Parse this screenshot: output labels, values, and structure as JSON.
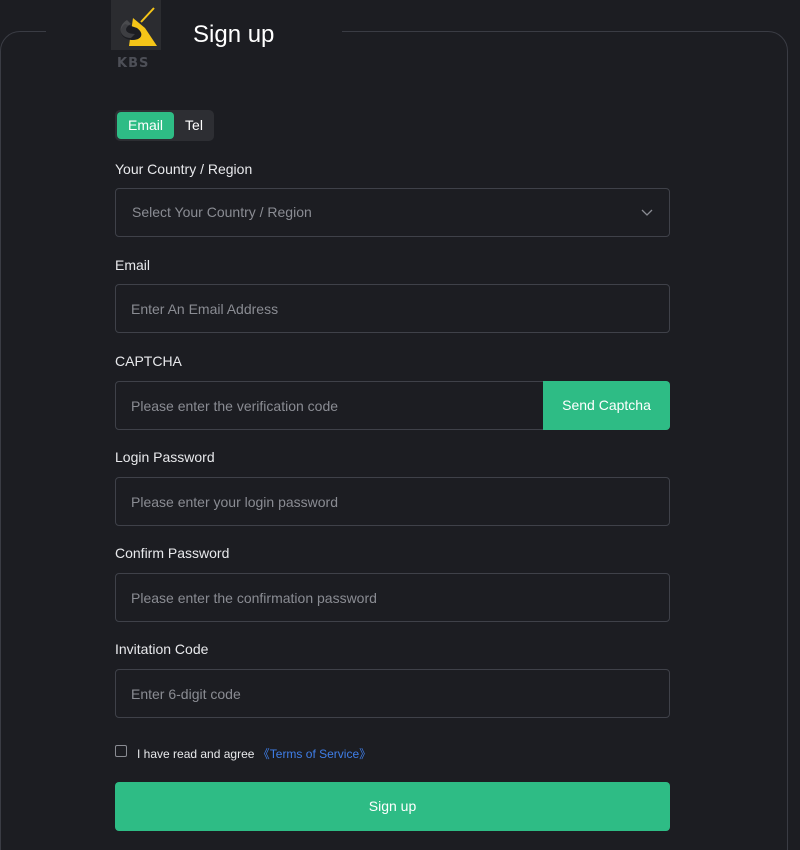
{
  "header": {
    "title": "Sign up",
    "logo_text": "KBS"
  },
  "tabs": {
    "email_label": "Email",
    "tel_label": "Tel",
    "active": "Email"
  },
  "form": {
    "country": {
      "label": "Your Country / Region",
      "placeholder": "Select Your Country / Region"
    },
    "email": {
      "label": "Email",
      "placeholder": "Enter An Email Address",
      "value": ""
    },
    "captcha": {
      "label": "CAPTCHA",
      "placeholder": "Please enter the verification code",
      "value": "",
      "button_label": "Send Captcha"
    },
    "password": {
      "label": "Login Password",
      "placeholder": "Please enter your login password",
      "value": ""
    },
    "confirm_password": {
      "label": "Confirm Password",
      "placeholder": "Please enter the confirmation password",
      "value": ""
    },
    "invitation": {
      "label": "Invitation Code",
      "placeholder": "Enter 6-digit code",
      "value": ""
    }
  },
  "agreement": {
    "text": "I have read and agree ",
    "link_text": "《Terms of Service》",
    "checked": false
  },
  "submit_label": "Sign up",
  "colors": {
    "accent": "#2ebc85",
    "link": "#3f7ee8",
    "background": "#1c1d22",
    "logo_yellow": "#f5c518"
  },
  "icons": {
    "logo": "kbs-logo-icon",
    "dropdown": "chevron-down-icon"
  }
}
